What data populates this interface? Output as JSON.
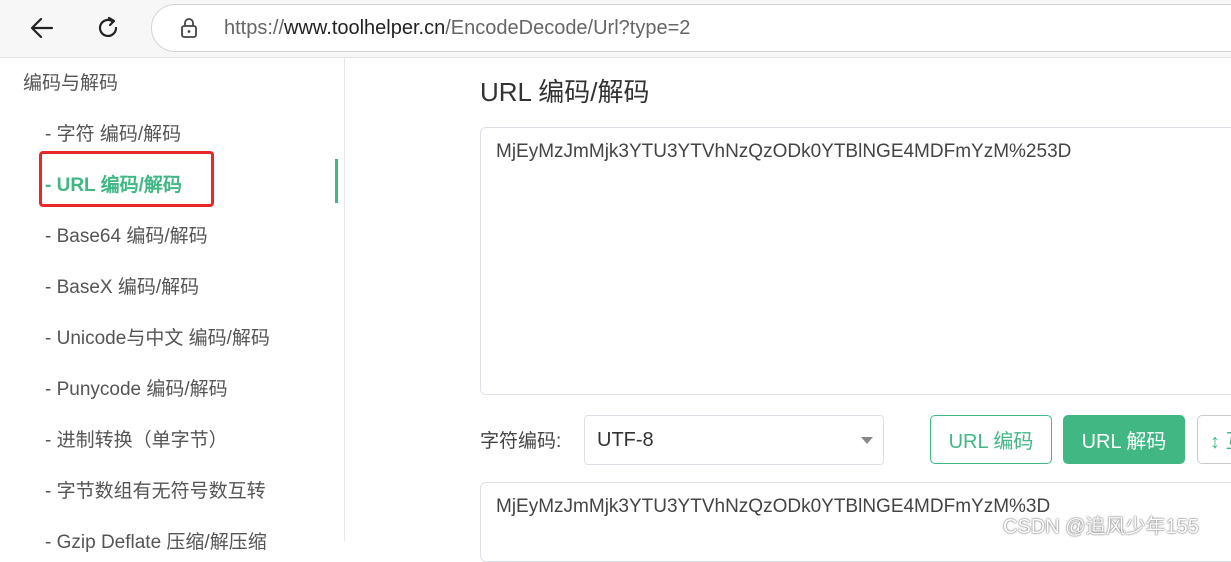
{
  "browser": {
    "url_prefix": "https://",
    "url_host": "www.toolhelper.cn",
    "url_path": "/EncodeDecode/Url?type=2"
  },
  "sidebar": {
    "title": "编码与解码",
    "items": [
      {
        "label": "- 字符  编码/解码",
        "active": false
      },
      {
        "label": "- URL  编码/解码",
        "active": true
      },
      {
        "label": "- Base64  编码/解码",
        "active": false
      },
      {
        "label": "- BaseX  编码/解码",
        "active": false
      },
      {
        "label": "- Unicode与中文  编码/解码",
        "active": false
      },
      {
        "label": "- Punycode  编码/解码",
        "active": false
      },
      {
        "label": "- 进制转换（单字节）",
        "active": false
      },
      {
        "label": "- 字节数组有无符号数互转",
        "active": false
      },
      {
        "label": "- Gzip Deflate 压缩/解压缩",
        "active": false
      }
    ]
  },
  "main": {
    "title": "URL 编码/解码",
    "input_text": "MjEyMzJmMjk3YTU3YTVhNzQzODk0YTBlNGE4MDFmYzM%253D",
    "encoding_label": "字符编码:",
    "encoding_value": "UTF-8",
    "encode_button": "URL 编码",
    "decode_button": "URL 解码",
    "swap_button": "↕ 互",
    "output_text": "MjEyMzJmMjk3YTU3YTVhNzQzODk0YTBlNGE4MDFmYzM%3D"
  },
  "watermark": "CSDN @追风少年155",
  "colors": {
    "accent": "#41b883",
    "highlight": "#e82828"
  }
}
